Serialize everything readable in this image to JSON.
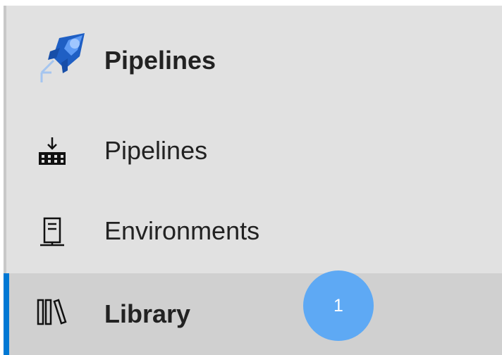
{
  "window": {
    "accent_color": "#0078d4",
    "background_color": "#e1e1e1",
    "selected_background": "#d0d0d0"
  },
  "section": {
    "title": "Pipelines",
    "icon": "pipelines-rocket-icon"
  },
  "items": [
    {
      "label": "Pipelines",
      "icon": "pipeline-build-icon",
      "selected": false
    },
    {
      "label": "Environments",
      "icon": "environment-server-icon",
      "selected": false
    },
    {
      "label": "Library",
      "icon": "library-books-icon",
      "selected": true
    }
  ],
  "step_badge": {
    "number": "1",
    "color": "#5ea9f4"
  }
}
